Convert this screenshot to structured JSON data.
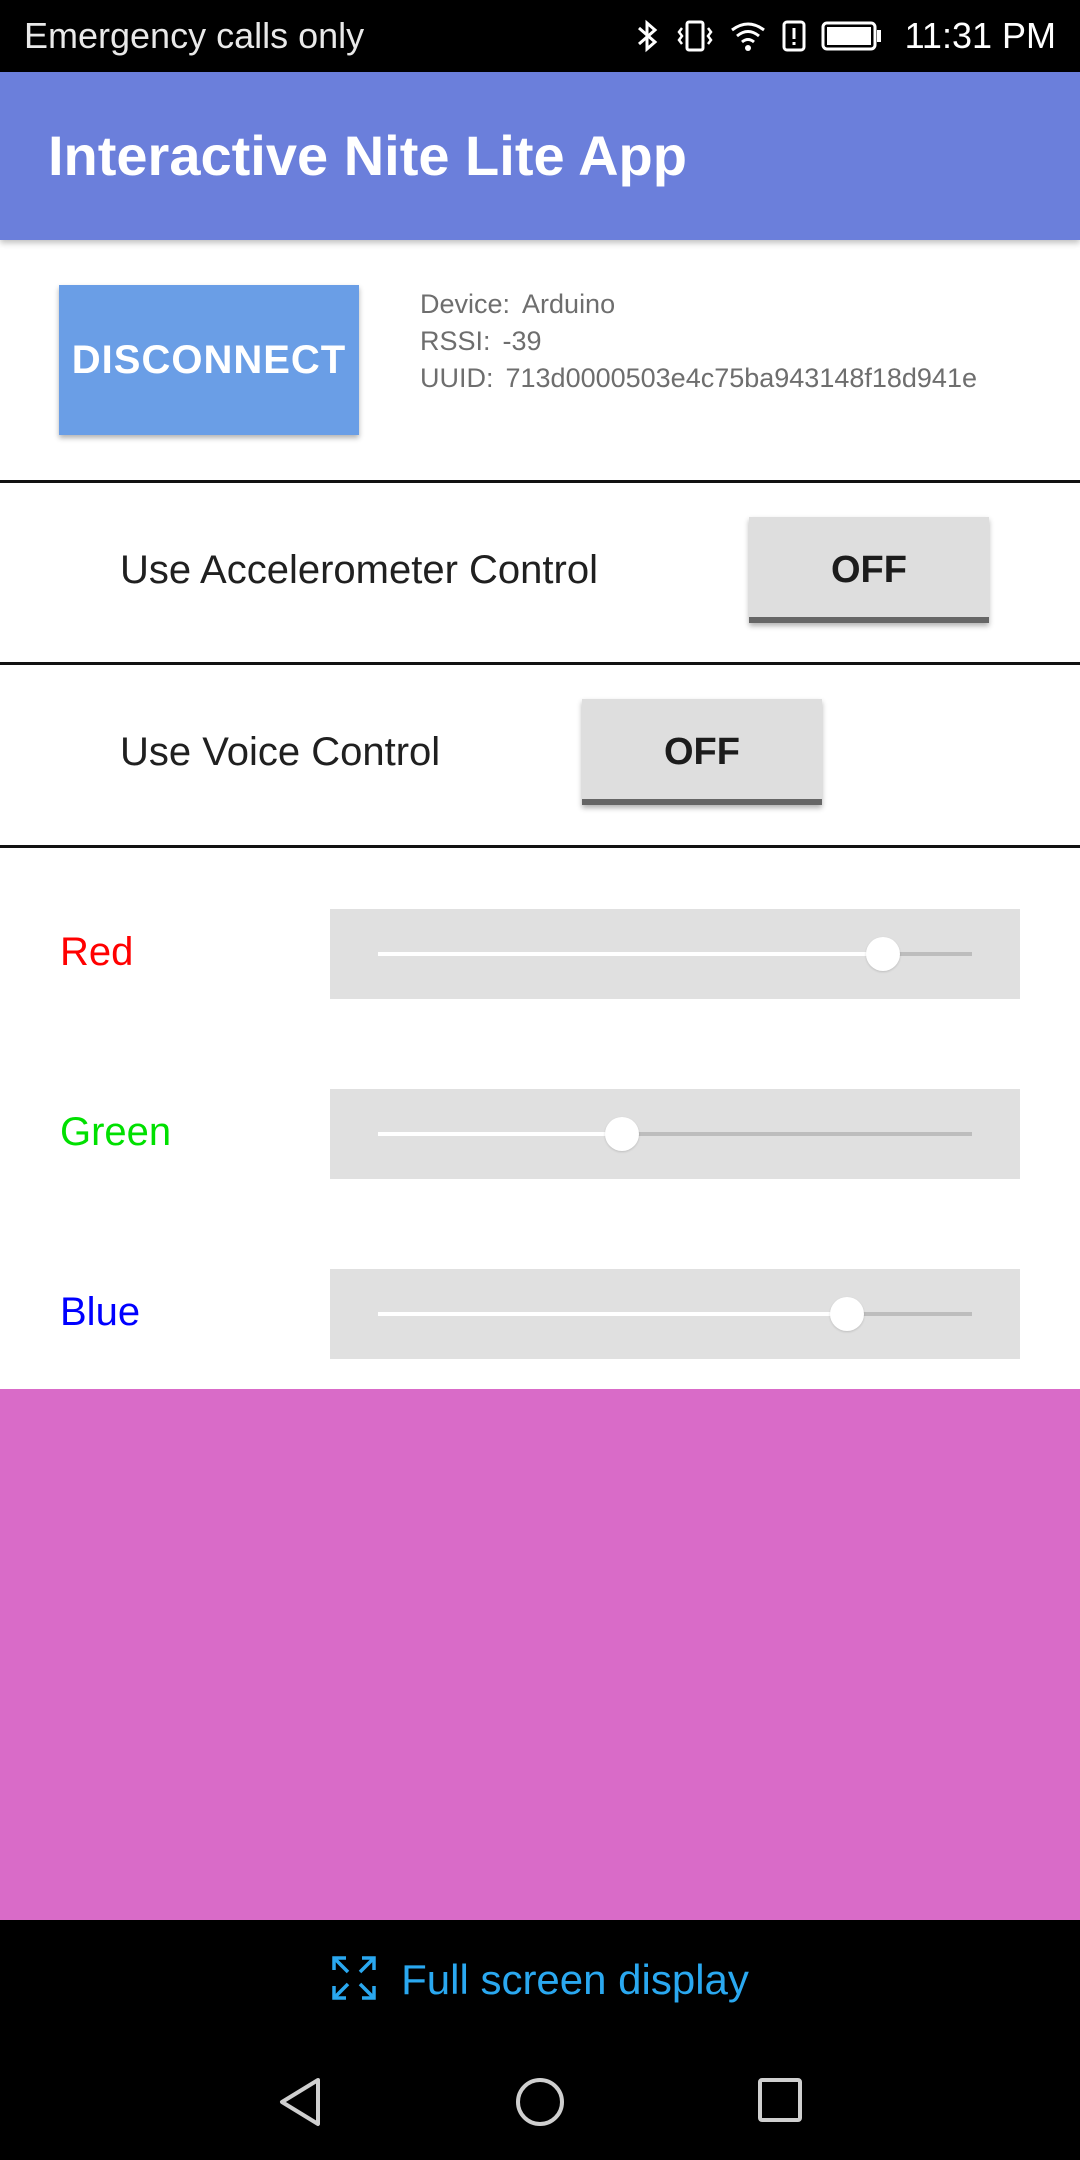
{
  "status_bar": {
    "carrier_text": "Emergency calls only",
    "time": "11:31 PM",
    "icons": [
      "bluetooth-icon",
      "vibrate-icon",
      "wifi-icon",
      "alert-icon",
      "battery-icon"
    ]
  },
  "app_bar": {
    "title": "Interactive Nite Lite App",
    "color": "#6b7fdb"
  },
  "device": {
    "button_label": "DISCONNECT",
    "device_label": "Device:",
    "device_value": "Arduino",
    "rssi_label": "RSSI:",
    "rssi_value": "-39",
    "uuid_label": "UUID:",
    "uuid_value": "713d0000503e4c75ba943148f18d941e"
  },
  "accelerometer": {
    "label": "Use Accelerometer Control",
    "state": "OFF"
  },
  "voice": {
    "label": "Use Voice Control",
    "state": "OFF"
  },
  "sliders": [
    {
      "label": "Red",
      "label_color": "#ff0000",
      "value": 0.85
    },
    {
      "label": "Green",
      "label_color": "#00e000",
      "value": 0.41
    },
    {
      "label": "Blue",
      "label_color": "#0000ff",
      "value": 0.79
    }
  ],
  "preview": {
    "color": "#d96bc8"
  },
  "fullscreen": {
    "label": "Full screen display",
    "accent": "#2aa8f0"
  },
  "nav_bar": {
    "icons": [
      "back-icon",
      "home-icon",
      "recents-icon"
    ]
  }
}
